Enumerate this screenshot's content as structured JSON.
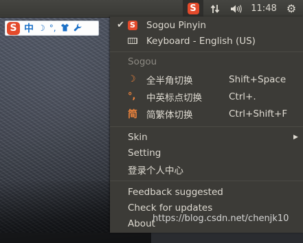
{
  "panel": {
    "sogou_logo": "S",
    "network_icon": "⇅",
    "volume_icon": "◀)))",
    "clock": "11:48",
    "gear_icon": "⚙"
  },
  "sogou_bar": {
    "logo": "S",
    "mode": "中",
    "icons": [
      "moon-icon",
      "punctuation-icon",
      "skin-shirt-icon",
      "wrench-icon"
    ],
    "moon": "☽",
    "punct": "°,",
    "shirt": "👕",
    "wrench": "🔧"
  },
  "menu": {
    "items": [
      {
        "label": "Sogou Pinyin",
        "checked": true,
        "icon": "sogou-logo"
      },
      {
        "label": "Keyboard - English (US)",
        "icon": "keyboard-icon"
      }
    ],
    "section_title": "Sogou",
    "options": [
      {
        "label": "全半角切换",
        "shortcut": "Shift+Space",
        "icon": "moon-icon"
      },
      {
        "label": "中英标点切换",
        "shortcut": "Ctrl+.",
        "icon": "punctuation-icon"
      },
      {
        "label": "简繁体切换",
        "shortcut": "Ctrl+Shift+F",
        "icon": "jian-icon"
      }
    ],
    "skin": "Skin",
    "setting": "Setting",
    "personal_center": "登录个人中心",
    "feedback": "Feedback suggested",
    "check_updates": "Check for updates",
    "about": "About"
  },
  "watermark": "https://blog.csdn.net/chenjk10",
  "colors": {
    "menu_bg": "#3c3b37",
    "panel_bg": "#3e3e3a",
    "sogou_red": "#e34a2b",
    "accent_orange": "#f0843c"
  }
}
